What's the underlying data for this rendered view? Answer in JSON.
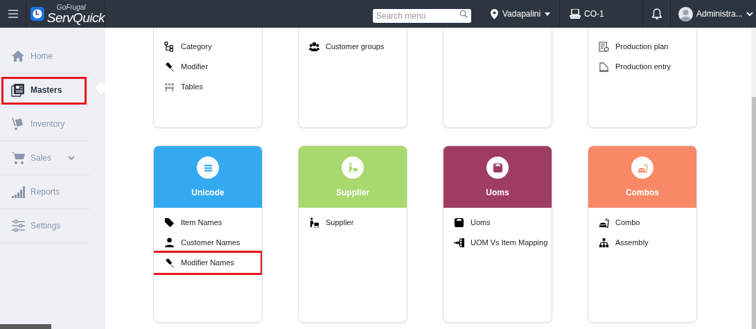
{
  "header": {
    "logo": {
      "brand": "GoFrugal",
      "product": "ServQuick"
    },
    "search": {
      "placeholder": "Search menu"
    },
    "location": "Vadapalini",
    "counter": "CO-1",
    "user": "Administra..."
  },
  "sidebar": {
    "items": [
      {
        "label": "Home",
        "kind": "link",
        "selected": false,
        "highlighted": false
      },
      {
        "label": "Masters",
        "kind": "link",
        "selected": true,
        "highlighted": true
      },
      {
        "label": "Inventory",
        "kind": "link",
        "selected": false,
        "highlighted": false
      },
      {
        "label": "Sales",
        "kind": "menu",
        "expanded": false,
        "selected": false,
        "highlighted": false
      },
      {
        "label": "Reports",
        "kind": "link",
        "selected": false,
        "highlighted": false
      },
      {
        "label": "Settings",
        "kind": "link",
        "selected": false,
        "highlighted": false
      }
    ]
  },
  "top_cards": [
    {
      "kind": "card",
      "items": [
        {
          "label": "Category",
          "highlighted": false
        },
        {
          "label": "Modifier",
          "highlighted": false
        },
        {
          "label": "Tables",
          "highlighted": false
        }
      ]
    },
    {
      "kind": "card",
      "items": [
        {
          "label": "Customer groups",
          "highlighted": false
        }
      ]
    },
    {
      "kind": "card"
    },
    {
      "kind": "card",
      "items": [
        {
          "label": "Production plan",
          "highlighted": false
        },
        {
          "label": "Production entry",
          "highlighted": false
        }
      ]
    }
  ],
  "cards": [
    {
      "title": "Unicode",
      "color": "#33aaf0",
      "items": [
        {
          "label": "Item Names",
          "highlighted": false
        },
        {
          "label": "Customer Names",
          "highlighted": false
        },
        {
          "label": "Modifier Names",
          "highlighted": true
        }
      ]
    },
    {
      "title": "Supplier",
      "color": "#a8d86e",
      "items": [
        {
          "label": "Supplier",
          "highlighted": false
        }
      ]
    },
    {
      "title": "Uoms",
      "color": "#9e3c64",
      "items": [
        {
          "label": "Uoms",
          "highlighted": false
        },
        {
          "label": "UOM Vs Item Mapping",
          "highlighted": false
        }
      ]
    },
    {
      "title": "Combos",
      "color": "#f88866",
      "items": [
        {
          "label": "Combo",
          "highlighted": false
        },
        {
          "label": "Assembly",
          "highlighted": false
        }
      ]
    }
  ]
}
